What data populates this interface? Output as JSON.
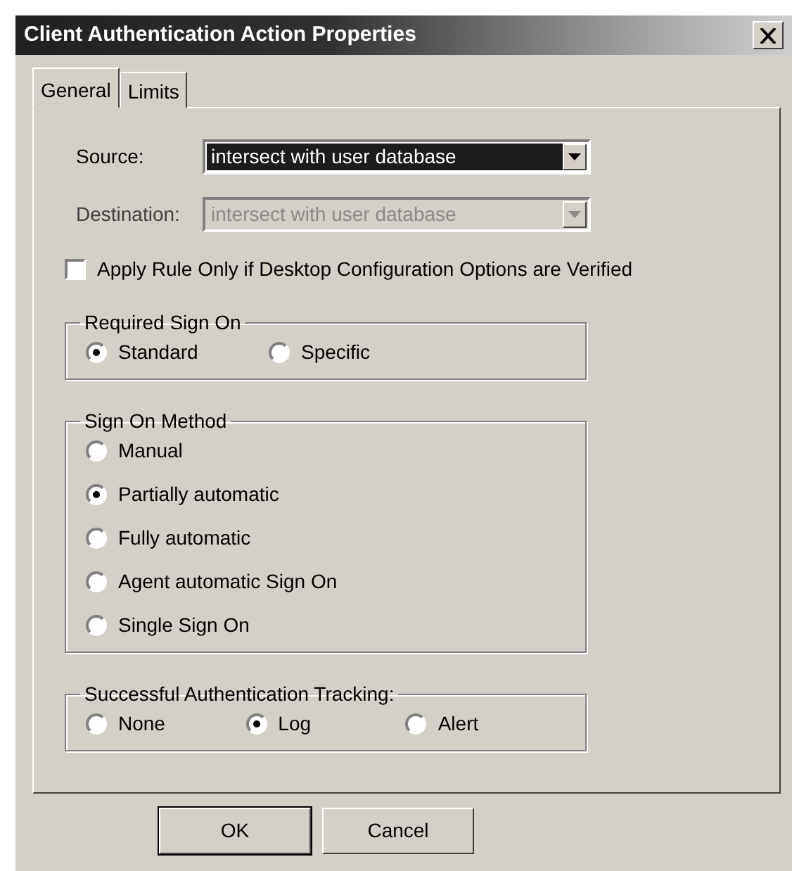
{
  "window": {
    "title": "Client Authentication Action Properties"
  },
  "tabs": [
    {
      "label": "General",
      "selected": true
    },
    {
      "label": "Limits",
      "selected": false
    }
  ],
  "fields": [
    {
      "label": "Source:",
      "value": "intersect with user database",
      "disabled": false,
      "focused": true
    },
    {
      "label": "Destination:",
      "value": "intersect with user database",
      "disabled": true,
      "focused": false
    }
  ],
  "checkbox": {
    "label": "Apply Rule Only if Desktop Configuration Options are Verified",
    "checked": false
  },
  "groups": [
    {
      "title": "Required Sign On",
      "kind": "row",
      "options": [
        {
          "label": "Standard",
          "selected": true
        },
        {
          "label": "Specific",
          "selected": false
        }
      ]
    },
    {
      "title": "Sign On Method",
      "kind": "column",
      "options": [
        {
          "label": "Manual",
          "selected": false
        },
        {
          "label": "Partially automatic",
          "selected": true
        },
        {
          "label": "Fully automatic",
          "selected": false
        },
        {
          "label": "Agent automatic Sign On",
          "selected": false
        },
        {
          "label": "Single Sign On",
          "selected": false
        }
      ]
    },
    {
      "title": "Successful Authentication Tracking:",
      "kind": "row",
      "options": [
        {
          "label": "None",
          "selected": false
        },
        {
          "label": "Log",
          "selected": true
        },
        {
          "label": "Alert",
          "selected": false
        }
      ]
    }
  ],
  "buttons": [
    {
      "label": "OK",
      "default": true
    },
    {
      "label": "Cancel",
      "default": false
    }
  ]
}
